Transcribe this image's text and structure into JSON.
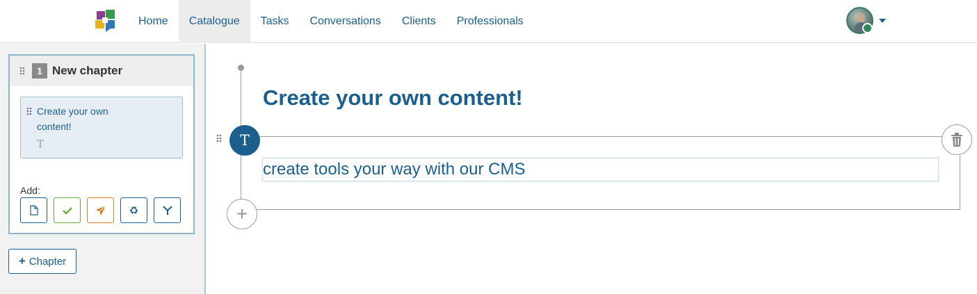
{
  "nav": {
    "items": [
      {
        "label": "Home",
        "active": false
      },
      {
        "label": "Catalogue",
        "active": true
      },
      {
        "label": "Tasks",
        "active": false
      },
      {
        "label": "Conversations",
        "active": false
      },
      {
        "label": "Clients",
        "active": false
      },
      {
        "label": "Professionals",
        "active": false
      }
    ],
    "accent": "#1a5f8e"
  },
  "sidebar": {
    "chapter": {
      "number": "1",
      "title": "New chapter",
      "lesson": {
        "title": "Create your own content!",
        "type_icon": "T"
      }
    },
    "add_label": "Add:",
    "add_buttons": [
      {
        "icon": "document-icon",
        "color": "#1a5f8e"
      },
      {
        "icon": "check-icon",
        "color": "#6aab3b"
      },
      {
        "icon": "send-icon",
        "color": "#e07a23"
      },
      {
        "icon": "recycle-icon",
        "color": "#1a5f8e"
      },
      {
        "icon": "filter-icon",
        "color": "#1a5f8e"
      }
    ],
    "add_chapter_label": "Chapter"
  },
  "editor": {
    "heading": "Create your own content!",
    "block_type": "T",
    "text_value": "create tools your way with our CMS",
    "add_icon": "+"
  }
}
